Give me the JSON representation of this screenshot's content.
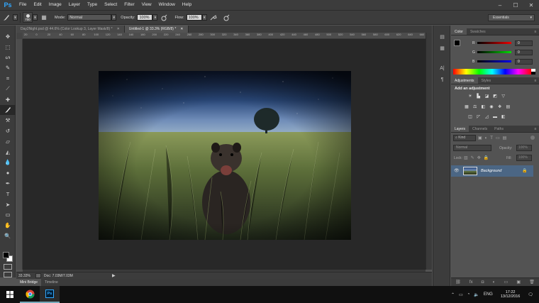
{
  "app": {
    "logo": "Ps"
  },
  "menu": [
    "File",
    "Edit",
    "Image",
    "Layer",
    "Type",
    "Select",
    "Filter",
    "View",
    "Window",
    "Help"
  ],
  "window_controls": {
    "minimize": "–",
    "maximize": "☐",
    "close": "✕"
  },
  "options": {
    "brush_size": "700",
    "mode_label": "Mode:",
    "mode_value": "Normal",
    "opacity_label": "Opacity:",
    "opacity_value": "100%",
    "flow_label": "Flow:",
    "flow_value": "100%",
    "workspace": "Essentials"
  },
  "tabs": [
    {
      "label": "Day2Night.psd @ 44.6% (Color Lookup 3, Layer Mask/8) *",
      "close": "✕"
    },
    {
      "label": "Untitled-1 @ 33.3% (RGB/8) *",
      "close": "✕"
    }
  ],
  "ruler_ticks": [
    "20",
    "0",
    "20",
    "40",
    "60",
    "80",
    "100",
    "120",
    "140",
    "160",
    "180",
    "200",
    "220",
    "240",
    "260",
    "280",
    "300",
    "320",
    "340",
    "360",
    "380",
    "400",
    "420",
    "440",
    "460",
    "480",
    "500",
    "520",
    "540",
    "560",
    "580",
    "600",
    "620",
    "640",
    "660"
  ],
  "status": {
    "zoom": "33.33%",
    "doc": "Doc: 7.03M/7.03M"
  },
  "bottom_tabs": [
    "Mini Bridge",
    "Timeline"
  ],
  "color_panel": {
    "tabs": [
      "Color",
      "Swatches"
    ],
    "r_label": "R",
    "r_value": "0",
    "g_label": "G",
    "g_value": "0",
    "b_label": "B",
    "b_value": "0"
  },
  "adjustments_panel": {
    "tabs": [
      "Adjustments",
      "Styles"
    ],
    "heading": "Add an adjustment"
  },
  "layers_panel": {
    "tabs": [
      "Layers",
      "Channels",
      "Paths"
    ],
    "filter": "Kind",
    "blend_mode": "Normal",
    "opacity_label": "Opacity:",
    "opacity_value": "100%",
    "lock_label": "Lock:",
    "fill_label": "Fill:",
    "fill_value": "100%",
    "layer_name": "Background"
  },
  "taskbar": {
    "lang": "ENG",
    "time": "17:22",
    "date": "13/12/2016"
  },
  "colors": {
    "chrome_dark": "#3c3c3c",
    "panel": "#535353",
    "canvas_bg": "#282828",
    "ps_blue": "#31a8ff",
    "selected_layer": "#4b6684"
  }
}
